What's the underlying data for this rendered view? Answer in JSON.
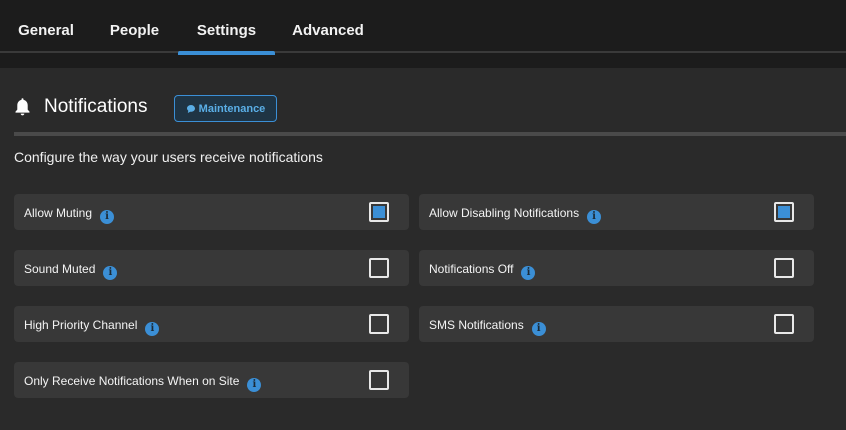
{
  "tabs": [
    {
      "label": "General",
      "active": false
    },
    {
      "label": "People",
      "active": false
    },
    {
      "label": "Settings",
      "active": true
    },
    {
      "label": "Advanced",
      "active": false
    }
  ],
  "section": {
    "icon": "bell-icon",
    "title": "Notifications",
    "badge": {
      "icon": "chat-bubble-icon",
      "label": "Maintenance"
    },
    "description": "Configure the way your users receive notifications"
  },
  "settings": [
    {
      "label": "Allow Muting",
      "checked": true
    },
    {
      "label": "Allow Disabling Notifications",
      "checked": true
    },
    {
      "label": "Sound Muted",
      "checked": false
    },
    {
      "label": "Notifications Off",
      "checked": false
    },
    {
      "label": "High Priority Channel",
      "checked": false
    },
    {
      "label": "SMS Notifications",
      "checked": false
    },
    {
      "label": "Only Receive Notifications When on Site",
      "checked": false
    }
  ],
  "colors": {
    "accent": "#3b8fd6",
    "background": "#1c1c1c",
    "panel": "#2a2a2a",
    "row": "#383838"
  }
}
